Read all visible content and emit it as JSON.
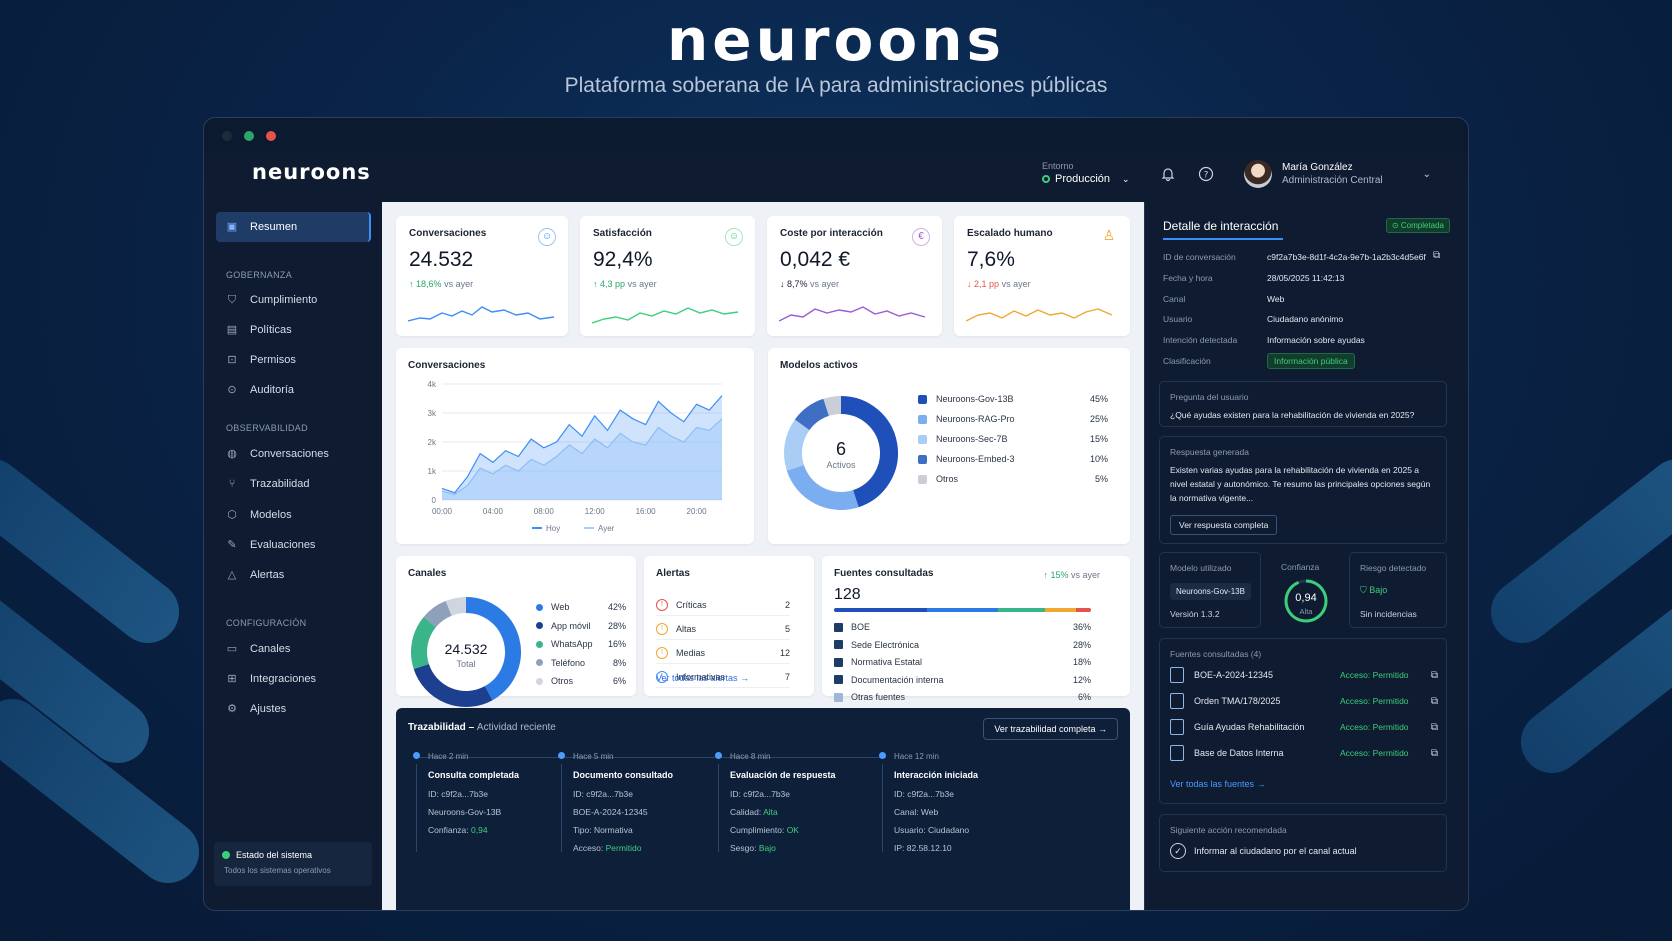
{
  "brand": {
    "name": "neuroons",
    "tagline": "Plataforma soberana de IA para administraciones públicas"
  },
  "colors": {
    "accent": "#3e8ef7",
    "success": "#3ccf7a",
    "danger": "#e5534b",
    "warn": "#f0a830",
    "navy": "#1e3c66"
  },
  "header": {
    "env_label": "Entorno",
    "env_value": "Producción",
    "user_name": "María González",
    "user_role": "Administración Central",
    "icons": [
      "bell-icon",
      "help-icon",
      "chevron-down-icon"
    ]
  },
  "sidebar": {
    "top_item": "Resumen",
    "sections": [
      {
        "title": "GOBERNANZA",
        "items": [
          "Cumplimiento",
          "Políticas",
          "Permisos",
          "Auditoría"
        ]
      },
      {
        "title": "OBSERVABILIDAD",
        "items": [
          "Conversaciones",
          "Trazabilidad",
          "Modelos",
          "Evaluaciones",
          "Alertas"
        ]
      },
      {
        "title": "CONFIGURACIÓN",
        "items": [
          "Canales",
          "Integraciones",
          "Ajustes"
        ]
      }
    ],
    "status_title": "Estado del sistema",
    "status_text": "Todos los sistemas operativos"
  },
  "kpis": [
    {
      "title": "Conversaciones",
      "value": "24.532",
      "delta": "18,6%",
      "suffix": "vs ayer",
      "dir": "up",
      "color": "#3e8ef7"
    },
    {
      "title": "Satisfacción",
      "value": "92,4%",
      "delta": "4,3 pp",
      "suffix": "vs ayer",
      "dir": "up",
      "color": "#3ccf7a"
    },
    {
      "title": "Coste por interacción",
      "value": "0,042 €",
      "delta": "8,7%",
      "suffix": "vs ayer",
      "dir": "down",
      "color": "#9a5bd6"
    },
    {
      "title": "Escalado humano",
      "value": "7,6%",
      "delta": "2,1 pp",
      "suffix": "vs ayer",
      "dir": "down",
      "color": "#f0a830"
    }
  ],
  "chart_data": [
    {
      "type": "area",
      "title": "Conversaciones",
      "x": [
        "00:00",
        "01:00",
        "02:00",
        "03:00",
        "04:00",
        "05:00",
        "06:00",
        "07:00",
        "08:00",
        "09:00",
        "10:00",
        "11:00",
        "12:00",
        "13:00",
        "14:00",
        "15:00",
        "16:00",
        "17:00",
        "18:00",
        "19:00",
        "20:00",
        "21:00",
        "22:00"
      ],
      "series": [
        {
          "name": "Hoy",
          "values": [
            400,
            250,
            800,
            1600,
            1300,
            1700,
            1500,
            2100,
            1800,
            2000,
            2600,
            2200,
            2900,
            2400,
            3100,
            2800,
            2600,
            3400,
            3000,
            2700,
            3300,
            3100,
            3600
          ]
        },
        {
          "name": "Ayer",
          "values": [
            300,
            200,
            500,
            1100,
            900,
            1200,
            1000,
            1400,
            1200,
            1500,
            1900,
            1600,
            2100,
            1800,
            2300,
            2000,
            1900,
            2500,
            2200,
            2000,
            2500,
            2400,
            2800
          ]
        }
      ],
      "yticks": [
        "0",
        "1k",
        "2k",
        "3k",
        "4k"
      ],
      "xticks": [
        "00:00",
        "04:00",
        "08:00",
        "12:00",
        "16:00",
        "20:00"
      ],
      "ylim": [
        0,
        4000
      ]
    },
    {
      "type": "pie",
      "title": "Modelos activos",
      "center_value": "6",
      "center_label": "Activos",
      "labels": [
        "Neuroons-Gov-13B",
        "Neuroons-RAG-Pro",
        "Neuroons-Sec-7B",
        "Neuroons-Embed-3",
        "Otros"
      ],
      "values": [
        45,
        25,
        15,
        10,
        5
      ],
      "colors": [
        "#1f4fb8",
        "#7aaef0",
        "#a9cdf5",
        "#3f6fc4",
        "#c9ced8"
      ]
    },
    {
      "type": "pie",
      "title": "Canales",
      "center_value": "24.532",
      "center_label": "Total",
      "labels": [
        "Web",
        "App móvil",
        "WhatsApp",
        "Teléfono",
        "Otros"
      ],
      "values": [
        42,
        28,
        16,
        8,
        6
      ],
      "colors": [
        "#2c7be5",
        "#1c3f8f",
        "#3ab58a",
        "#8fa0bb",
        "#d0d6e0"
      ]
    }
  ],
  "alerts": {
    "title": "Alertas",
    "rows": [
      {
        "label": "Críticas",
        "count": "2",
        "color": "#e5534b",
        "icon": "critical-alert-icon"
      },
      {
        "label": "Altas",
        "count": "5",
        "color": "#f0a830",
        "icon": "high-alert-icon"
      },
      {
        "label": "Medias",
        "count": "12",
        "color": "#f0a830",
        "icon": "medium-alert-icon"
      },
      {
        "label": "Informativas",
        "count": "7",
        "color": "#3e8ef7",
        "icon": "info-alert-icon"
      }
    ],
    "link": "Ver todas las alertas"
  },
  "sources": {
    "title": "Fuentes consultadas",
    "delta": "15%",
    "delta_suffix": "vs ayer",
    "total": "128",
    "rows": [
      {
        "label": "BOE",
        "pct": "36%",
        "value": 36
      },
      {
        "label": "Sede Electrónica",
        "pct": "28%",
        "value": 28
      },
      {
        "label": "Normativa Estatal",
        "pct": "18%",
        "value": 18
      },
      {
        "label": "Documentación interna",
        "pct": "12%",
        "value": 12
      },
      {
        "label": "Otras fuentes",
        "pct": "6%",
        "value": 6
      }
    ],
    "bar_colors": [
      "#1f4fb8",
      "#2c7be5",
      "#3ab58a",
      "#f0a830",
      "#e5534b"
    ]
  },
  "trace": {
    "title": "Trazabilidad",
    "subtitle": "Actividad reciente",
    "button": "Ver trazabilidad completa",
    "events": [
      {
        "when": "Hace 2 min",
        "title": "Consulta completada",
        "lines": [
          "ID: c9f2a...7b3e",
          "Neuroons-Gov-13B",
          "Confianza: 0,94"
        ]
      },
      {
        "when": "Hace 5 min",
        "title": "Documento consultado",
        "lines": [
          "ID: c9f2a...7b3e",
          "BOE-A-2024-12345",
          "Tipo: Normativa",
          "Acceso: Permitido"
        ]
      },
      {
        "when": "Hace 8 min",
        "title": "Evaluación de respuesta",
        "lines": [
          "ID: c9f2a...7b3e",
          "Calidad: Alta",
          "Cumplimiento: OK",
          "Sesgo: Bajo"
        ]
      },
      {
        "when": "Hace 12 min",
        "title": "Interacción iniciada",
        "lines": [
          "ID: c9f2a...7b3e",
          "Canal: Web",
          "Usuario: Ciudadano",
          "IP: 82.58.12.10"
        ]
      }
    ]
  },
  "detail": {
    "title": "Detalle de interacción",
    "status": "Completada",
    "fields": [
      {
        "k": "ID de conversación",
        "v": "c9f2a7b3e-8d1f-4c2a-9e7b-1a2b3c4d5e6f"
      },
      {
        "k": "Fecha y hora",
        "v": "28/05/2025 11:42:13"
      },
      {
        "k": "Canal",
        "v": "Web"
      },
      {
        "k": "Usuario",
        "v": "Ciudadano anónimo"
      },
      {
        "k": "Intención detectada",
        "v": "Información sobre ayudas"
      },
      {
        "k": "Clasificación",
        "v": "Información pública"
      }
    ],
    "question_label": "Pregunta del usuario",
    "question": "¿Qué ayudas existen para la rehabilitación de vivienda en 2025?",
    "answer_label": "Respuesta generada",
    "answer": "Existen varias ayudas para la rehabilitación de vivienda en 2025 a nivel estatal y autonómico. Te resumo las principales opciones según la normativa vigente...",
    "answer_button": "Ver respuesta completa",
    "model_label": "Modelo utilizado",
    "model": "Neuroons-Gov-13B",
    "version": "Versión 1.3.2",
    "confidence_label": "Confianza",
    "confidence": "0,94",
    "confidence_value": 0.94,
    "confidence_level": "Alta",
    "risk_label": "Riesgo detectado",
    "risk": "Bajo",
    "risk_note": "Sin incidencias",
    "sources_label": "Fuentes consultadas (4)",
    "access_label": "Acceso:",
    "access_value": "Permitido",
    "sources": [
      "BOE-A-2024-12345",
      "Orden TMA/178/2025",
      "Guía Ayudas Rehabilitación",
      "Base de Datos Interna"
    ],
    "sources_link": "Ver todas las fuentes",
    "next_label": "Siguiente acción recomendada",
    "next": "Informar al ciudadano por el canal actual"
  }
}
